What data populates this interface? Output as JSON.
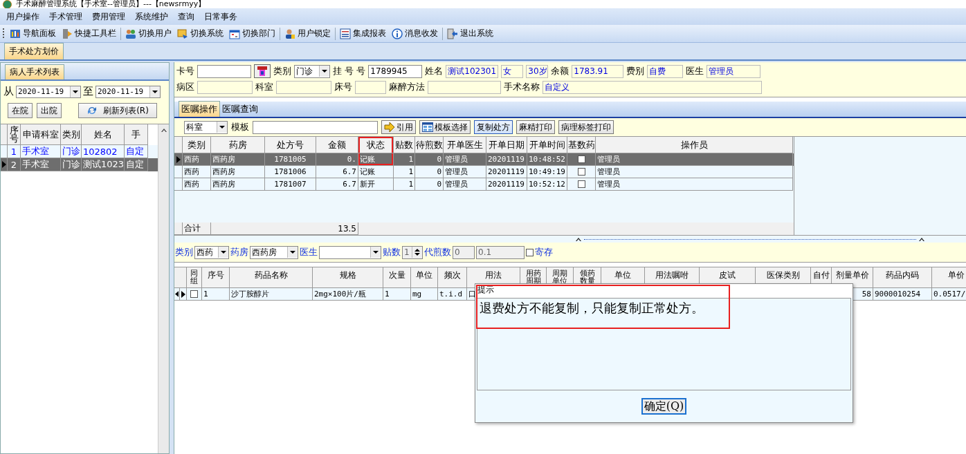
{
  "window": {
    "title": "手术麻醉管理系统【手术室--管理员】---【newsrmyy】"
  },
  "menu": [
    "用户操作",
    "手术管理",
    "费用管理",
    "系统维护",
    "查询",
    "日常事务"
  ],
  "toolbar": [
    "导航面板",
    "快捷工具栏",
    "切换用户",
    "切换系统",
    "切换部门",
    "用户锁定",
    "集成报表",
    "消息收发",
    "退出系统"
  ],
  "main_tab": {
    "label": "手术处方划价",
    "selected": true
  },
  "patient_list": {
    "tab": "病人手术列表",
    "from_label": "从",
    "from": "2020-11-19",
    "to_label": "至",
    "to": "2020-11-19",
    "buttons": [
      "在院",
      "出院"
    ],
    "refresh": "刷新列表(R)",
    "columns": [
      "序号",
      "申请科室",
      "类别",
      "姓名",
      "手"
    ],
    "rows": [
      {
        "selected": false,
        "color": "#0000ff",
        "cells": [
          "1",
          "手术室",
          "门诊",
          "102802",
          "自定"
        ]
      },
      {
        "selected": true,
        "cells": [
          "2",
          "手术室",
          "门诊",
          "测试1023",
          "自定"
        ]
      }
    ]
  },
  "patient": {
    "card_no": {
      "label": "卡号",
      "kind": "input"
    },
    "card_reader": {
      "kind": "card-button"
    },
    "visit_type": {
      "label": "类别",
      "kind": "select",
      "value": "门诊"
    },
    "registration_no": {
      "label": "挂 号 号",
      "kind": "input",
      "value": "1789945"
    },
    "name": {
      "label": "姓名",
      "kind": "display",
      "value": "测试102301"
    },
    "sex": {
      "kind": "display",
      "value": "女"
    },
    "age": {
      "kind": "display",
      "value": "30岁"
    },
    "balance": {
      "label": "余额",
      "kind": "display",
      "value": "1783.91"
    },
    "fee_type": {
      "label": "费别",
      "kind": "display",
      "value": "自费"
    },
    "doctor": {
      "label": "医生",
      "kind": "display",
      "value": "管理员"
    },
    "ward": {
      "label": "病区",
      "kind": "display"
    },
    "department": {
      "label": "科室",
      "kind": "display"
    },
    "bed_no": {
      "label": "床号",
      "kind": "display"
    },
    "anesthesia_method": {
      "label": "麻醉方法",
      "kind": "display"
    },
    "operation_name": {
      "label": "手术名称",
      "kind": "display",
      "value": "自定义"
    }
  },
  "order_tabs": [
    {
      "label": "医嘱操作",
      "selected": true
    },
    {
      "label": "医嘱查询",
      "selected": false
    }
  ],
  "order_toolbar": {
    "department": "科室",
    "template_label": "模板",
    "buttons": [
      {
        "label": "引用",
        "kind": "arrow",
        "focused": false
      },
      {
        "label": "模板选择",
        "kind": "grid",
        "focused": false
      },
      {
        "label": "复制处方",
        "kind": "plain",
        "focused": true
      },
      {
        "label": "麻精打印",
        "kind": "plain",
        "focused": false
      },
      {
        "label": "病理标签打印",
        "kind": "plain",
        "focused": false
      }
    ]
  },
  "prescriptions": {
    "columns": [
      {
        "label": "类别",
        "highlighted": false
      },
      {
        "label": "药房",
        "highlighted": false
      },
      {
        "label": "处方号",
        "highlighted": false
      },
      {
        "label": "金额",
        "highlighted": false
      },
      {
        "label": "状态",
        "highlighted": true
      },
      {
        "label": "贴数",
        "highlighted": false
      },
      {
        "label": "待煎数",
        "highlighted": false
      },
      {
        "label": "开单医生",
        "highlighted": false
      },
      {
        "label": "开单日期",
        "highlighted": false
      },
      {
        "label": "开单时间",
        "highlighted": false
      },
      {
        "label": "基数药",
        "highlighted": false
      },
      {
        "label": "操作员",
        "highlighted": false
      }
    ],
    "rows": [
      {
        "selected": true,
        "status_highlighted": true,
        "base_drug": false,
        "cells": [
          "西药",
          "西药房",
          "1781005",
          "0.",
          "记账",
          "1",
          "0",
          "管理员",
          "20201119",
          "10:48:52",
          null,
          "管理员"
        ]
      },
      {
        "selected": false,
        "status_highlighted": false,
        "base_drug": false,
        "cells": [
          "西药",
          "西药房",
          "1781006",
          "6.7",
          "记账",
          "1",
          "0",
          "管理员",
          "20201119",
          "10:49:19",
          null,
          "管理员"
        ]
      },
      {
        "selected": false,
        "status_highlighted": false,
        "base_drug": false,
        "cells": [
          "西药",
          "西药房",
          "1781007",
          "6.7",
          "新开",
          "1",
          "0",
          "管理员",
          "20201119",
          "10:52:12",
          null,
          "管理员"
        ]
      }
    ],
    "total_label": "合计",
    "total_amount": "13.5"
  },
  "filter": [
    {
      "label": "类别",
      "kind": "select",
      "value": "西药",
      "disabled": false
    },
    {
      "label": "药房",
      "kind": "select",
      "value": "西药房",
      "disabled": false
    },
    {
      "label": "医生",
      "kind": "select",
      "disabled": false
    },
    {
      "label": "贴数",
      "kind": "spin",
      "value": "1",
      "disabled": true
    },
    {
      "label": "代煎数",
      "kind": "input",
      "value": "0",
      "disabled": true
    },
    {
      "kind": "input",
      "value": "0.1",
      "disabled": true
    },
    {
      "kind": "checkbox",
      "label": "寄存",
      "checked": false
    }
  ],
  "drugs": {
    "columns": [
      "同组",
      "序号",
      "药品名称",
      "规格",
      "次量",
      "单位",
      "频次",
      "用法",
      "用药周期",
      "周期单位",
      "领药数量",
      "单位",
      "用法嘱咐",
      "皮试",
      "医保类别",
      "自付",
      "剂量单价",
      "药品内码",
      "单价"
    ],
    "rows": [
      {
        "selected": true,
        "grouped": false,
        "cells": [
          null,
          "1",
          "沙丁胺醇片",
          "2mg×100片/瓶",
          "1",
          "mg",
          "t.i.d",
          "口",
          null,
          null,
          null,
          null,
          null,
          null,
          null,
          null,
          "58",
          "9000010254",
          "0.0517/"
        ]
      }
    ]
  },
  "dialog": {
    "title": "提示",
    "message": "退费处方不能复制，只能复制正常处方。",
    "button": "确定(Q)",
    "highlighted": true
  }
}
